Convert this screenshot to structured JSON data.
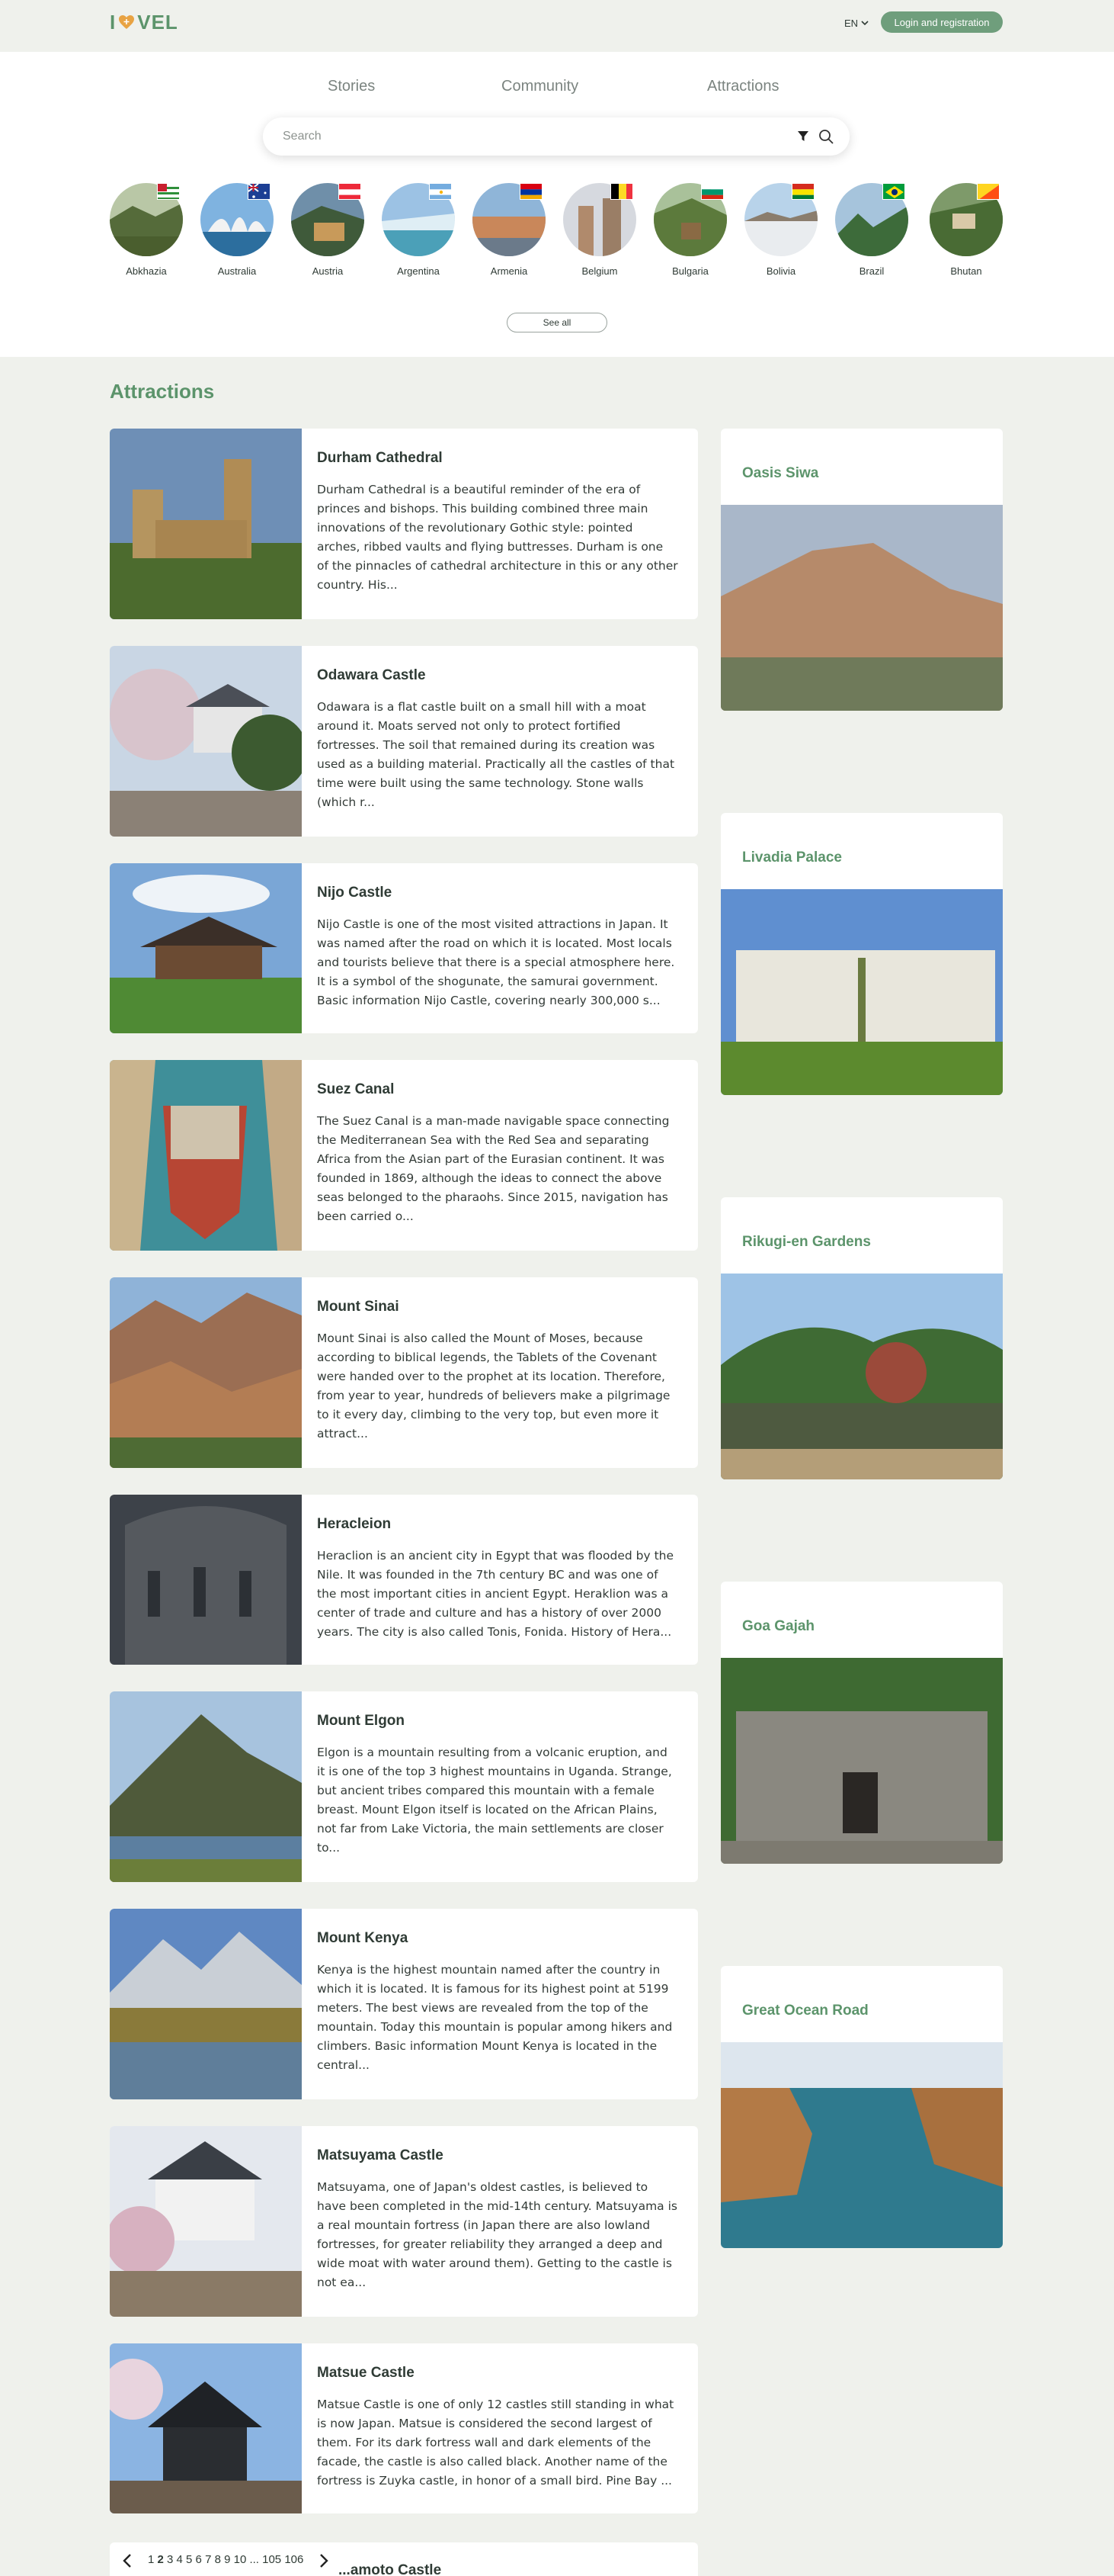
{
  "header": {
    "logo_pre": "I",
    "logo_post": "VEL",
    "lang": "EN",
    "login_label": "Login and registration"
  },
  "nav": [
    "Stories",
    "Community",
    "Attractions"
  ],
  "search": {
    "placeholder": "Search"
  },
  "countries": [
    "Abkhazia",
    "Australia",
    "Austria",
    "Argentina",
    "Armenia",
    "Belgium",
    "Bulgaria",
    "Bolivia",
    "Brazil",
    "Bhutan"
  ],
  "see_all_label": "See all",
  "section_title": "Attractions",
  "attractions": [
    {
      "title": "Durham Cathedral",
      "text": "Durham Cathedral is a beautiful reminder of the era of princes and bishops. This building combined three main innovations of the revolutionary Gothic style: pointed arches, ribbed vaults and flying buttresses. Durham is one of the pinnacles of cathedral architecture in this or any other country. His..."
    },
    {
      "title": "Odawara Castle",
      "text": "Odawara is a flat castle built on a small hill with a moat around it. Moats served not only to protect fortified fortresses. The soil that remained during its creation was used as a building material. Practically all the castles of that time were built using the same technology. Stone walls (which r..."
    },
    {
      "title": "Nijo Castle",
      "text": "Nijo Castle is one of the most visited attractions in Japan. It was named after the road on which it is located. Most locals and tourists believe that there is a special atmosphere here. It is a symbol of the shogunate, the samurai government. Basic information Nijo Castle, covering nearly 300,000 s..."
    },
    {
      "title": "Suez Canal",
      "text": "The Suez Canal is a man-made navigable space connecting the Mediterranean Sea with the Red Sea and separating Africa from the Asian part of the Eurasian continent. It was founded in 1869, although the ideas to connect the above seas belonged to the pharaohs. Since 2015, navigation has been carried o..."
    },
    {
      "title": "Mount Sinai",
      "text": "Mount Sinai is also called the Mount of Moses, because according to biblical legends, the Tablets of the Covenant were handed over to the prophet at its location. Therefore, from year to year, hundreds of believers make a pilgrimage to it every day, climbing to the very top, but even more it attract..."
    },
    {
      "title": "Heracleion",
      "text": "Heraclion is an ancient city in Egypt that was flooded by the Nile. It was founded in the 7th century BC and was one of the most important cities in ancient Egypt. Heraklion was a center of trade and culture and has a history of over 2000 years. The city is also called Tonis, Fonida. History of Hera..."
    },
    {
      "title": "Mount Elgon",
      "text": "Elgon is a mountain resulting from a volcanic eruption, and it is one of the top 3 highest mountains in Uganda. Strange, but ancient tribes compared this mountain with a female breast. Mount Elgon itself is located on the African Plains, not far from Lake Victoria, the main settlements are closer to..."
    },
    {
      "title": "Mount Kenya",
      "text": "Kenya is the highest mountain named after the country in which it is located. It is famous for its highest point at 5199 meters. The best views are revealed from the top of the mountain. Today this mountain is popular among hikers and climbers. Basic information Mount Kenya is located in the central..."
    },
    {
      "title": "Matsuyama Castle",
      "text": "Matsuyama, one of Japan's oldest castles, is believed to have been completed in the mid-14th century. Matsuyama is a real mountain fortress (in Japan there are also lowland fortresses, for greater reliability they arranged a deep and wide moat with water around them). Getting to the castle is not ea..."
    },
    {
      "title": "Matsue Castle",
      "text": "Matsue Castle is one of only 12 castles still standing in what is now Japan. Matsue is considered the second largest of them. For its dark fortress wall and dark elements of the facade, the castle is also called black. Another name of the fortress is Zuyka castle, in honor of a small bird. Pine Bay ..."
    }
  ],
  "sidebar": [
    "Oasis Siwa",
    "Livadia Palace",
    "Rikugi-en Gardens",
    "Goa Gajah",
    "Great Ocean Road"
  ],
  "pager": {
    "before": "1",
    "current": "2",
    "after": "3 4 5 6 7 8 9 10 ... 105 106",
    "peek_title": "...amoto Castle"
  },
  "colors": {
    "accent": "#5c946b",
    "background": "#eff1ec"
  }
}
